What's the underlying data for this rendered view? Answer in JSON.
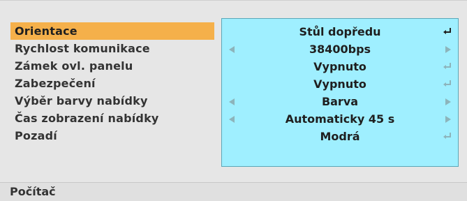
{
  "menu": {
    "items": [
      {
        "label": "Orientace",
        "value": "Stůl dopředu",
        "selected": true,
        "control": "enter"
      },
      {
        "label": "Rychlost komunikace",
        "value": "38400bps",
        "selected": false,
        "control": "arrows"
      },
      {
        "label": "Zámek ovl. panelu",
        "value": "Vypnuto",
        "selected": false,
        "control": "enter"
      },
      {
        "label": "Zabezpečení",
        "value": "Vypnuto",
        "selected": false,
        "control": "enter"
      },
      {
        "label": "Výběr barvy nabídky",
        "value": "Barva",
        "selected": false,
        "control": "arrows"
      },
      {
        "label": "Čas zobrazení nabídky",
        "value": "Automaticky 45 s",
        "selected": false,
        "control": "arrows"
      },
      {
        "label": "Pozadí",
        "value": "Modrá",
        "selected": false,
        "control": "enter"
      }
    ]
  },
  "footer": {
    "label": "Počítač"
  },
  "colors": {
    "selected_bg": "#f5b04a",
    "panel_bg": "#9fefff",
    "menu_bg": "#e6e6e6"
  }
}
